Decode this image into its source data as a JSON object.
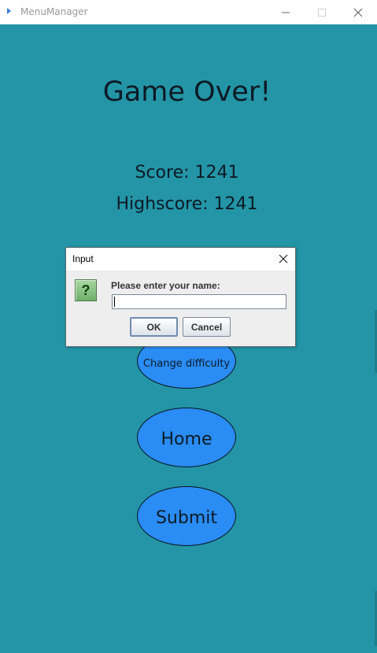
{
  "window": {
    "title": "MenuManager",
    "icon": "java-app-icon",
    "controls": [
      "minimize-icon",
      "maximize-icon",
      "close-icon"
    ]
  },
  "game": {
    "heading": "Game Over!",
    "score_text": "Score: 1241",
    "highscore_text": "Highscore: 1241",
    "background_color": "#2395a6",
    "button_color": "#2a8cf5"
  },
  "buttons": {
    "change_difficulty": "Change difficulty",
    "home": "Home",
    "submit": "Submit"
  },
  "dialog": {
    "title": "Input",
    "icon": "question-icon",
    "prompt": "Please enter your name:",
    "input_value": "",
    "ok_label": "OK",
    "cancel_label": "Cancel"
  }
}
